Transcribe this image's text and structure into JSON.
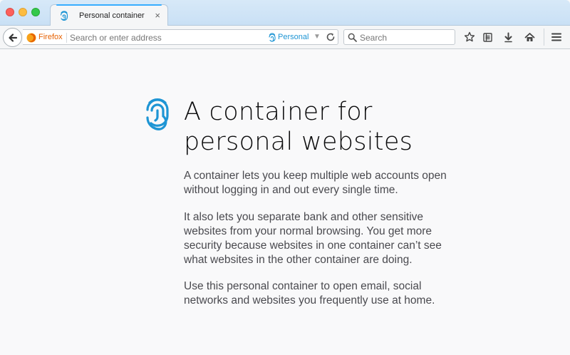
{
  "tab": {
    "title": "Personal container",
    "close_glyph": "×",
    "icon": "fingerprint-icon"
  },
  "urlbar": {
    "identity_label": "Firefox",
    "placeholder": "Search or enter address",
    "value": "",
    "container_label": "Personal",
    "dropmarker": "▼"
  },
  "searchbar": {
    "placeholder": "Search",
    "value": ""
  },
  "toolbar": {
    "icons": [
      "back-arrow-icon",
      "bookmark-star-icon",
      "reading-list-icon",
      "download-arrow-icon",
      "home-icon",
      "hamburger-menu-icon"
    ]
  },
  "page": {
    "heading_line1": "A container for",
    "heading_line2": "personal websites",
    "paragraphs": [
      "A container lets you keep multiple web accounts open without logging in and out every single time.",
      "It also lets you separate bank and other sensitive websites from your normal browsing. You get more security because websites in one container can’t see what websites in the other container are doing.",
      "Use this personal container to open email, social networks and websites you frequently use at home."
    ]
  },
  "colors": {
    "container_accent": "#1e95d4",
    "firefox_orange": "#e66000",
    "tab_highlight": "#37adff"
  }
}
